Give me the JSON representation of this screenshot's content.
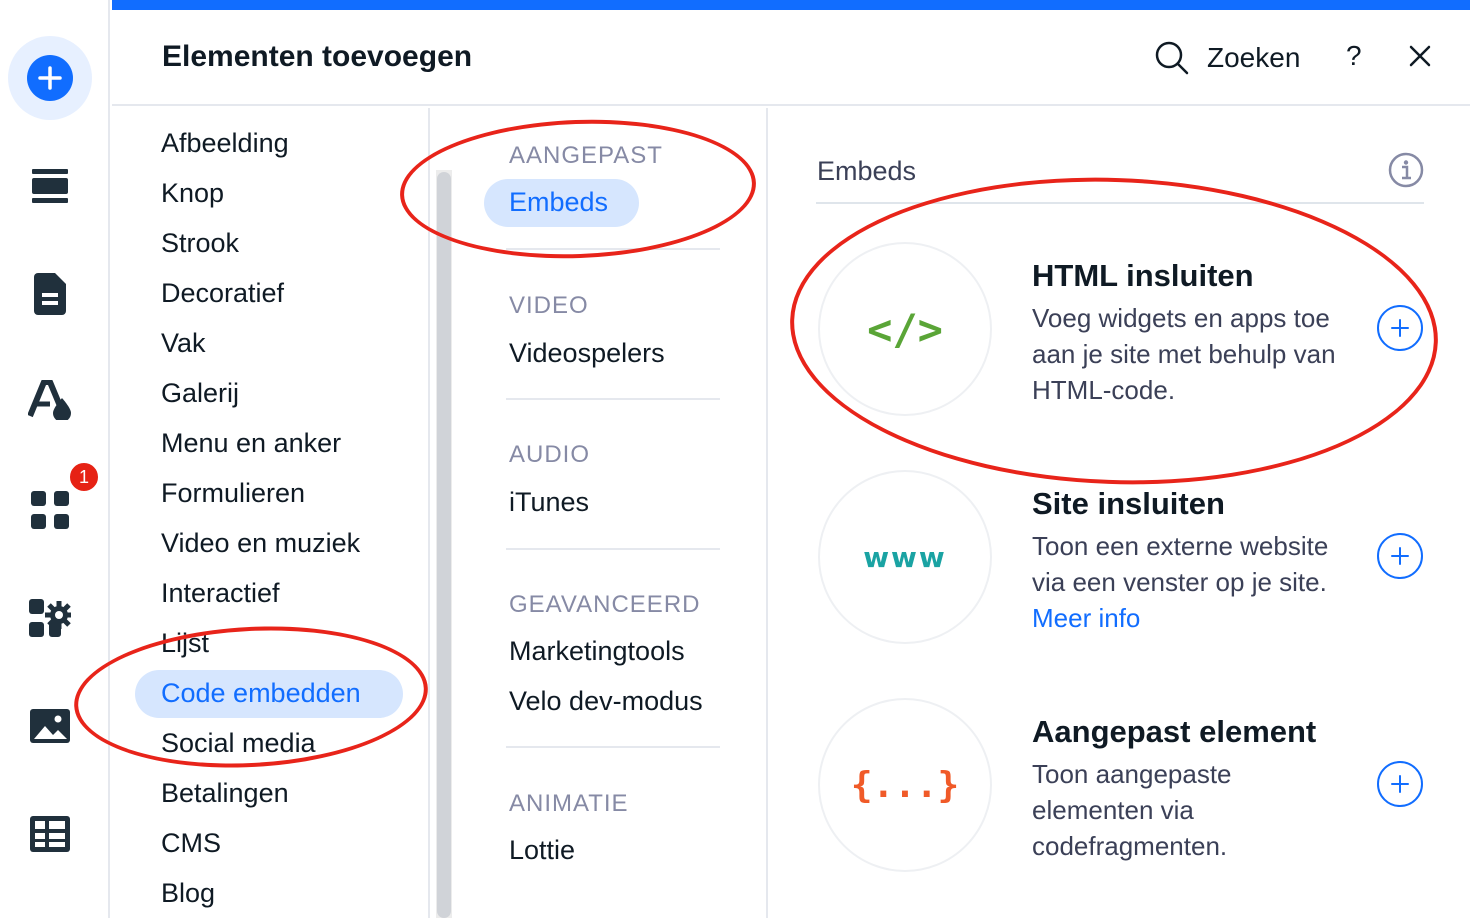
{
  "panel": {
    "title": "Elementen toevoegen",
    "search_label": "Zoeken",
    "help_label": "?"
  },
  "rail": {
    "badge_count": "1",
    "icons": [
      "add-icon",
      "sections-icon",
      "pages-icon",
      "design-icon",
      "apps-icon",
      "business-icon",
      "media-icon",
      "cms-icon"
    ]
  },
  "categories": {
    "items": [
      "Afbeelding",
      "Knop",
      "Strook",
      "Decoratief",
      "Vak",
      "Galerij",
      "Menu en anker",
      "Formulieren",
      "Video en muziek",
      "Interactief",
      "Lijst",
      "Code embedden",
      "Social media",
      "Betalingen",
      "CMS",
      "Blog"
    ],
    "selected": "Code embedden"
  },
  "subcategories": {
    "aangepast": {
      "heading": "AANGEPAST",
      "items": [
        "Embeds"
      ]
    },
    "video": {
      "heading": "VIDEO",
      "items": [
        "Videospelers"
      ]
    },
    "audio": {
      "heading": "AUDIO",
      "items": [
        "iTunes"
      ]
    },
    "geavanceerd": {
      "heading": "GEAVANCEERD",
      "items": [
        "Marketingtools",
        "Velo dev-modus"
      ]
    },
    "animatie": {
      "heading": "ANIMATIE",
      "items": [
        "Lottie"
      ]
    },
    "selected": "Embeds"
  },
  "embeds": {
    "heading": "Embeds",
    "items": [
      {
        "title": "HTML insluiten",
        "description": "Voeg widgets en apps toe aan je site met behulp van HTML-code.",
        "icon": "code-icon",
        "icon_text": "</>",
        "icon_color": "#5aa537"
      },
      {
        "title": "Site insluiten",
        "description": "Toon een externe website via een venster op je site.",
        "link": "Meer info",
        "icon": "www-icon",
        "icon_text": "www",
        "icon_color": "#1aa3a3"
      },
      {
        "title": "Aangepast element",
        "description": "Toon aangepaste elementen via codefragmenten.",
        "icon": "braces-icon",
        "icon_text": "{...}",
        "icon_color": "#f05a28"
      }
    ]
  },
  "colors": {
    "accent": "#116dff",
    "selected_bg": "#d6e6fe",
    "annotation": "#e8241a",
    "badge": "#e62214"
  }
}
